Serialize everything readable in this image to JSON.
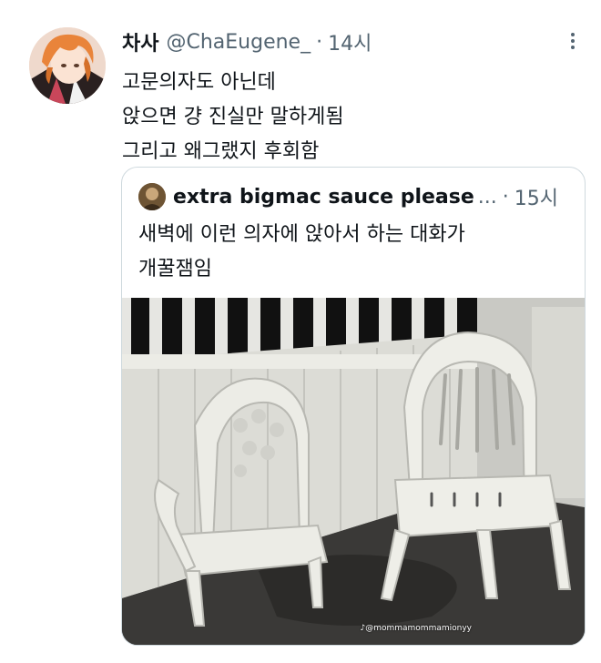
{
  "tweet": {
    "display_name": "차사",
    "handle": "@ChaEugene_",
    "separator": "·",
    "time": "14시",
    "lines": [
      "고문의자도 아닌데",
      "앉으면 걍 진실만 말하게됨",
      "그리고 왜그랬지 후회함"
    ],
    "avatar_icon": "anime-avatar-icon",
    "more_icon": "more-vertical-icon"
  },
  "quote": {
    "display_name": "extra bigmac sauce please",
    "ellipsis": "...",
    "separator": "·",
    "time": "15시",
    "lines": [
      "새벽에 이런 의자에 앉아서 하는 대화가",
      "개꿀잼임"
    ],
    "avatar_icon": "round-avatar-icon",
    "image": {
      "subject": "two white plastic chairs",
      "watermark": "♪@mommamommamionyy"
    }
  },
  "colors": {
    "text": "#0f1419",
    "secondary": "#536471",
    "border": "#cfd9de"
  }
}
